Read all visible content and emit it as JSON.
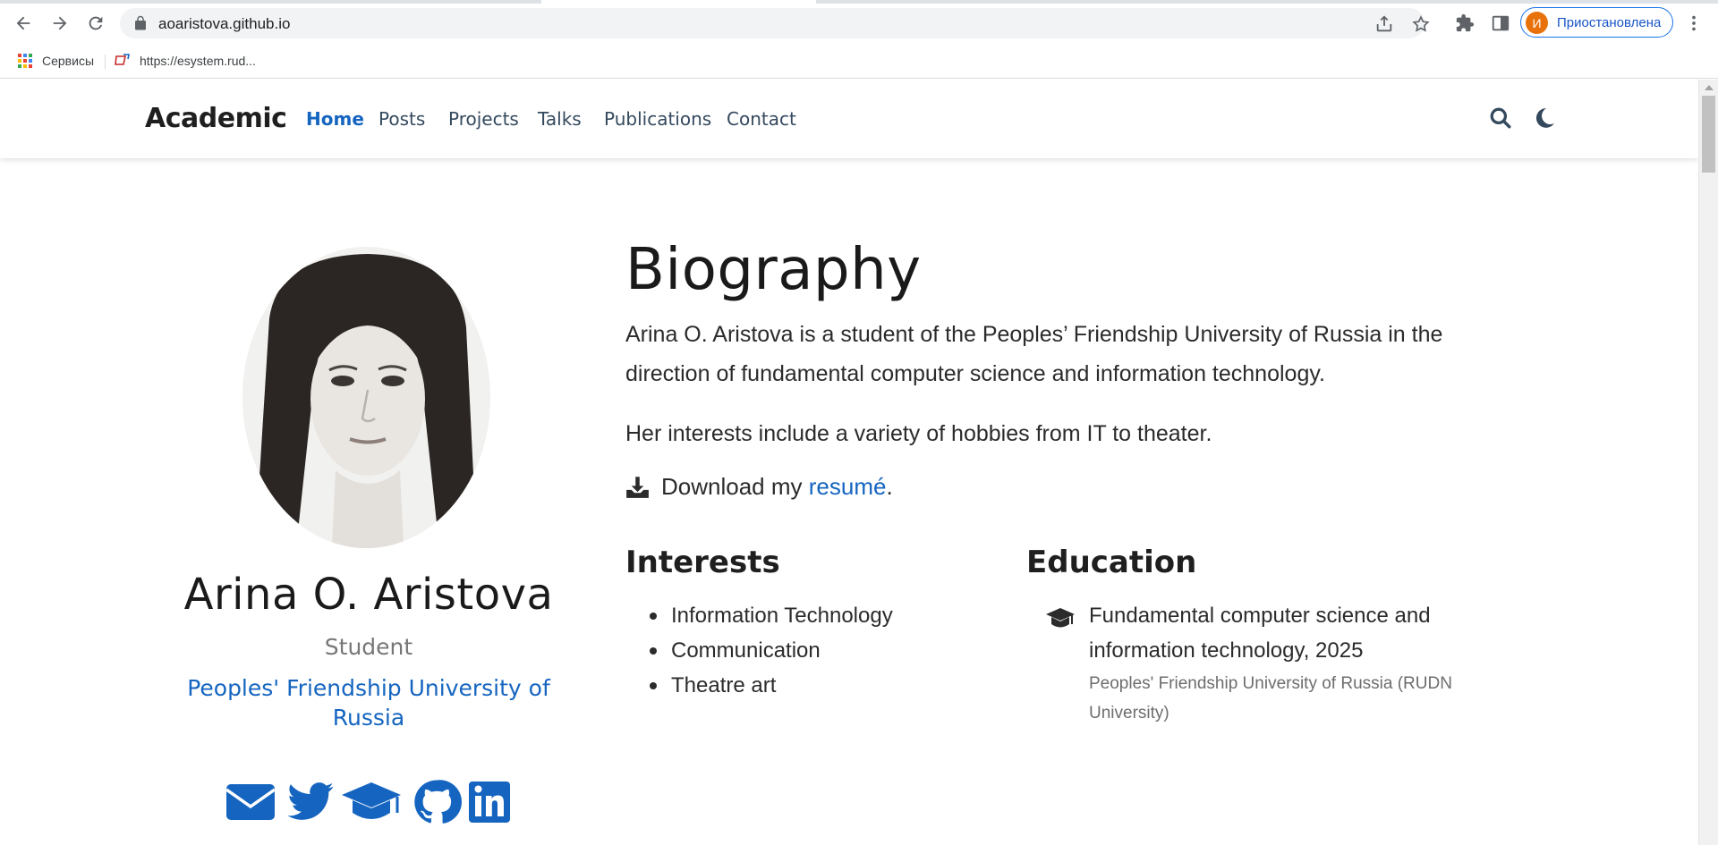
{
  "browser": {
    "url": "aoaristova.github.io",
    "profile_initial": "И",
    "profile_status": "Приостановлена",
    "bookmarks": [
      {
        "label": "Сервисы",
        "icon": "apps-grid-icon"
      },
      {
        "label": "https://esystem.rud...",
        "icon": "site-favicon-icon"
      }
    ]
  },
  "site": {
    "brand": "Academic",
    "nav": [
      "Home",
      "Posts",
      "Projects",
      "Talks",
      "Publications",
      "Contact"
    ],
    "active_nav": "Home"
  },
  "profile": {
    "name": "Arina O. Aristova",
    "role": "Student",
    "organization": "Peoples' Friendship University of Russia",
    "social": [
      "envelope-icon",
      "twitter-icon",
      "graduation-cap-icon",
      "github-icon",
      "linkedin-icon"
    ]
  },
  "biography": {
    "heading": "Biography",
    "paragraph1": "Arina O. Aristova is a student of the Peoples’ Friendship University of Russia in the direction of fundamental computer science and information technology.",
    "paragraph2": "Her interests include a variety of hobbies from IT to theater.",
    "download_prefix": "Download my ",
    "download_link": "resumé",
    "download_suffix": "."
  },
  "interests": {
    "heading": "Interests",
    "items": [
      "Information Technology",
      "Communication",
      "Theatre art"
    ]
  },
  "education": {
    "heading": "Education",
    "course": "Fundamental computer science and information technology, 2025",
    "institution": "Peoples' Friendship University of Russia (RUDN University)"
  },
  "colors": {
    "accent": "#1565c0",
    "profile_chip_border": "#1a73e8",
    "avatar_badge": "#e8710a"
  }
}
